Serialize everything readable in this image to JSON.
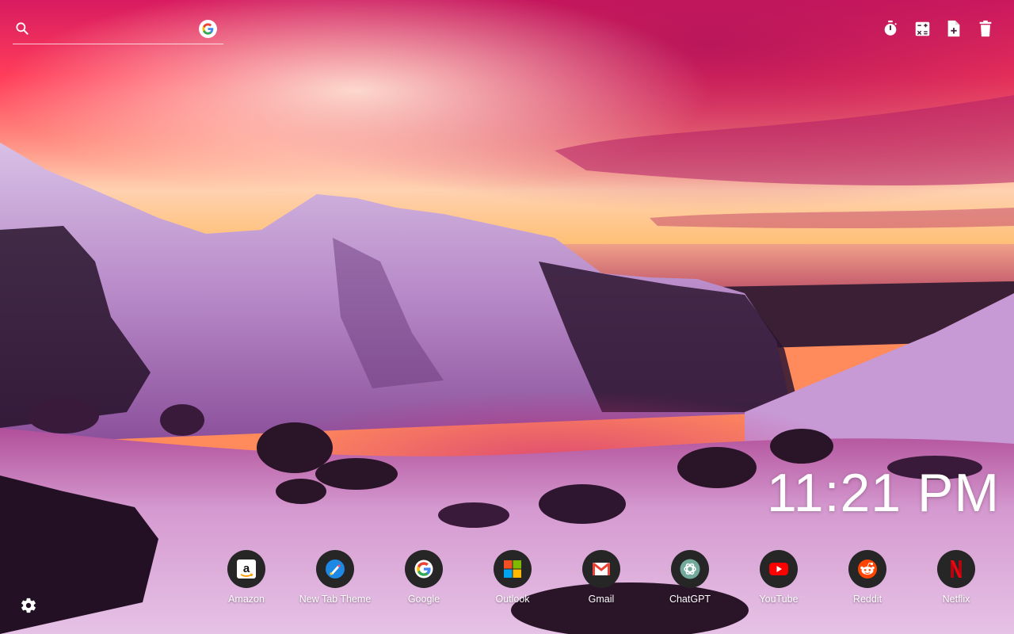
{
  "search": {
    "placeholder": "",
    "engine_icon": "google-icon"
  },
  "toolbar": {
    "icons": [
      "timer-icon",
      "calculator-icon",
      "add-note-icon",
      "trash-icon"
    ]
  },
  "clock": {
    "time": "11:21 PM"
  },
  "shortcuts": [
    {
      "label": "Amazon",
      "icon": "amazon-icon"
    },
    {
      "label": "New Tab Theme",
      "icon": "new-tab-theme-icon"
    },
    {
      "label": "Google",
      "icon": "google-icon"
    },
    {
      "label": "Outlook",
      "icon": "outlook-icon"
    },
    {
      "label": "Gmail",
      "icon": "gmail-icon"
    },
    {
      "label": "ChatGPT",
      "icon": "chatgpt-icon"
    },
    {
      "label": "YouTube",
      "icon": "youtube-icon"
    },
    {
      "label": "Reddit",
      "icon": "reddit-icon"
    },
    {
      "label": "Netflix",
      "icon": "netflix-icon"
    }
  ],
  "settings": {
    "icon": "gear-icon"
  },
  "colors": {
    "sky_top": "#c2185b",
    "sky_horizon": "#ffc58a",
    "snow": "#d9a6d9",
    "shortcut_bg": "#262626"
  }
}
